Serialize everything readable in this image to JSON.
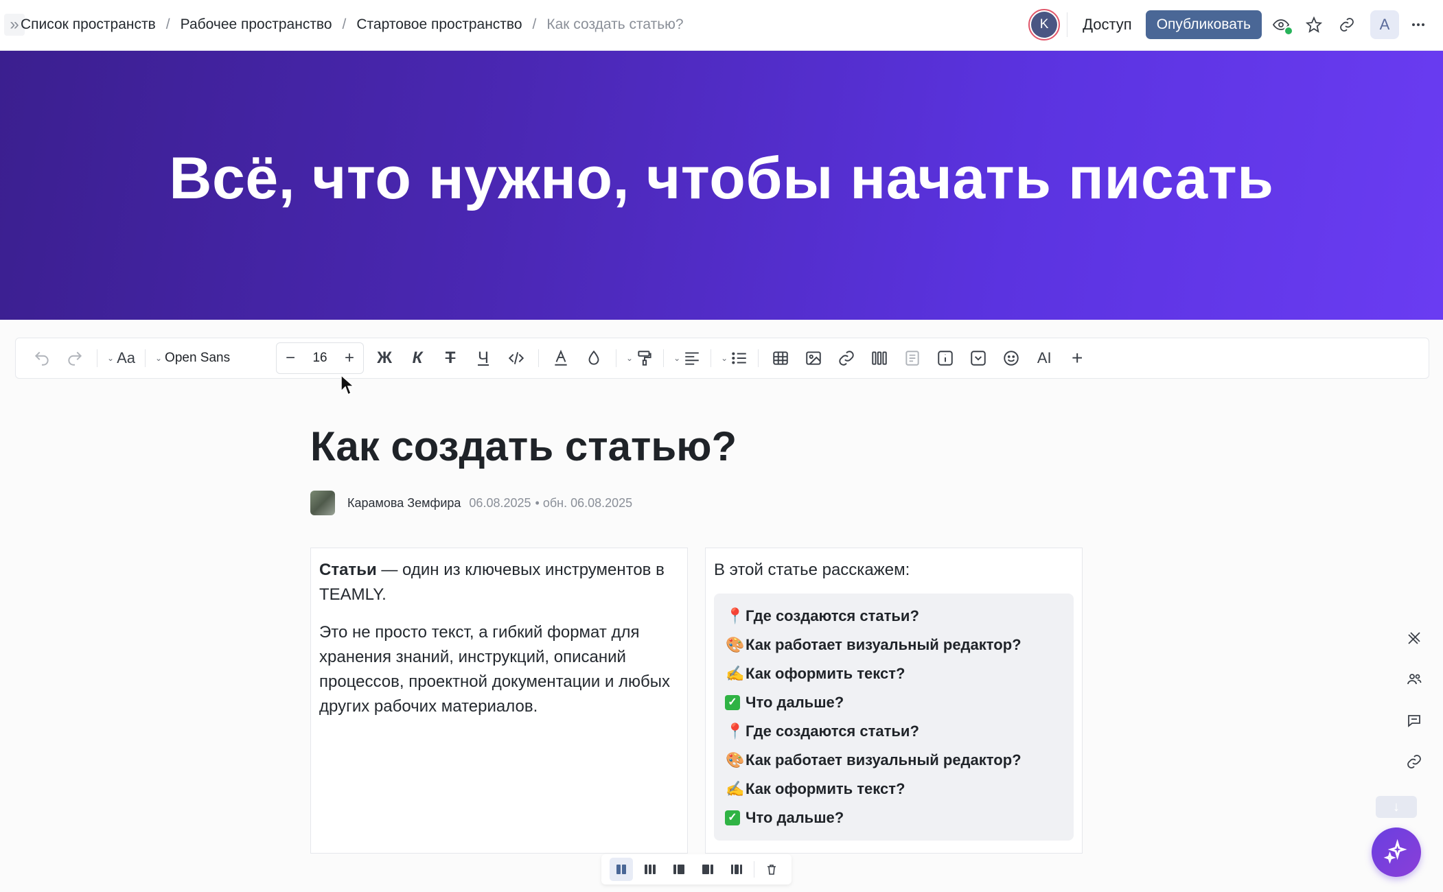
{
  "breadcrumbs": {
    "items": [
      "Список пространств",
      "Рабочее пространство",
      "Стартовое пространство"
    ],
    "current": "Как создать статью?"
  },
  "header": {
    "avatar_initial": "K",
    "access_label": "Доступ",
    "publish_label": "Опубликовать",
    "user_initial": "A"
  },
  "banner": {
    "title": "Всё, что нужно, чтобы начать писать",
    "gradient_colors": [
      "#3b1f8f",
      "#6a3cf2"
    ]
  },
  "toolbar": {
    "font_name": "Open Sans",
    "font_size": "16",
    "text_style_glyph": "Aa",
    "bold_glyph": "Ж",
    "italic_glyph": "К",
    "strike_glyph": "Т",
    "underline_glyph": "Ч",
    "ai_label": "AI",
    "add_glyph": "+"
  },
  "document": {
    "title": "Как создать статью?",
    "author": "Карамова Земфира",
    "created": "06.08.2025",
    "updated": "• обн. 06.08.2025",
    "left_column": {
      "p1_bold": "Статьи",
      "p1_rest": " — один из ключевых инструментов в TEAMLY.",
      "p2": "Это не просто текст, а гибкий формат для хранения знаний, инструкций, описаний процессов, проектной документации и любых других рабочих материалов."
    },
    "right_column": {
      "intro": "В этой статье расскажем:",
      "toc": [
        {
          "icon": "pin-icon",
          "emoji": "📍",
          "label": "Где создаются статьи?"
        },
        {
          "icon": "palette-icon",
          "emoji": "🎨",
          "label": "Как работает визуальный редактор?"
        },
        {
          "icon": "writing-hand-icon",
          "emoji": "✍",
          "label": "Как оформить текст?"
        },
        {
          "icon": "check-icon",
          "emoji": "✓",
          "label": "Что дальше?"
        },
        {
          "icon": "pin-icon",
          "emoji": "📍",
          "label": "Где создаются статьи?"
        },
        {
          "icon": "palette-icon",
          "emoji": "🎨",
          "label": "Как работает визуальный редактор?"
        },
        {
          "icon": "writing-hand-icon",
          "emoji": "✍",
          "label": "Как оформить текст?"
        },
        {
          "icon": "check-icon",
          "emoji": "✓",
          "label": "Что дальше?"
        }
      ]
    }
  },
  "colors": {
    "publish_button": "#4a6796",
    "ai_fab": "#6a3fe0",
    "status_online": "#27b35a"
  }
}
